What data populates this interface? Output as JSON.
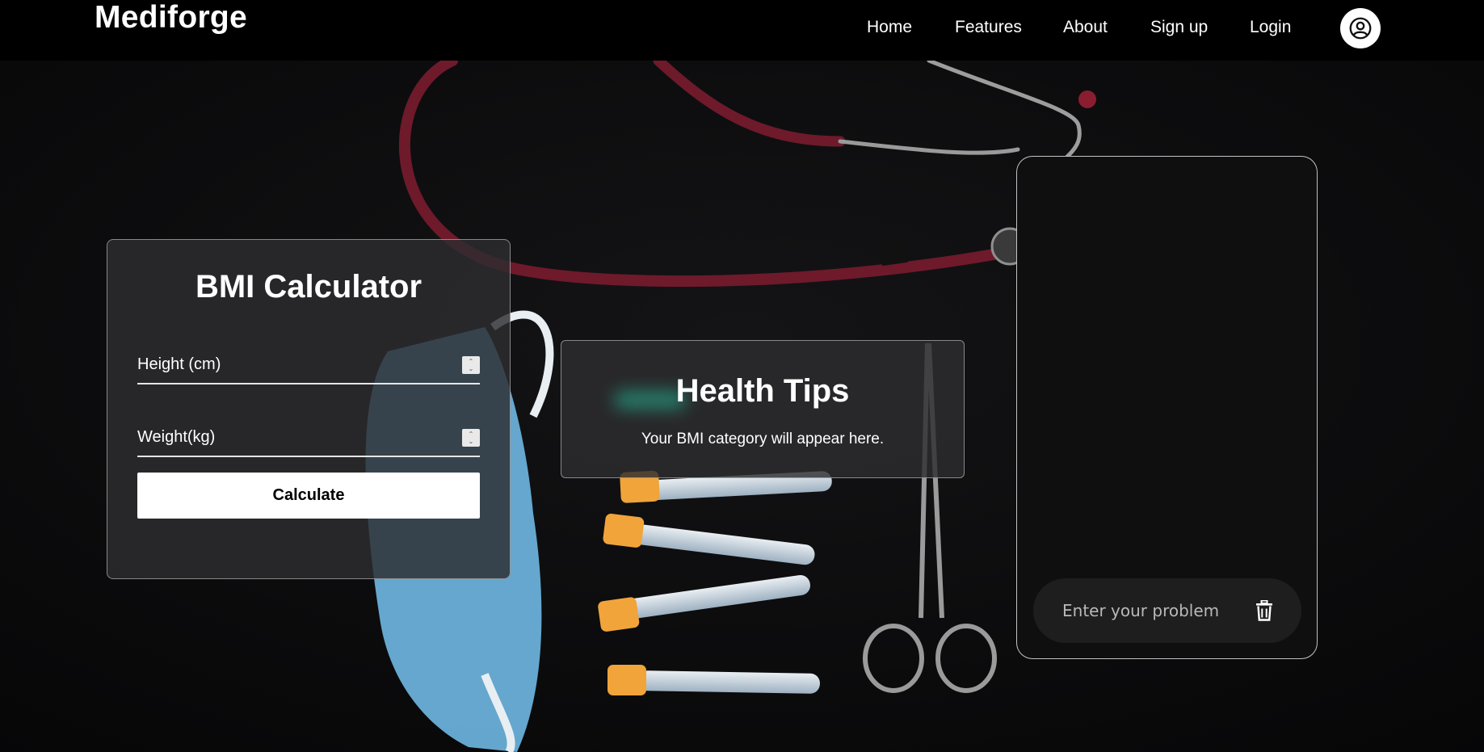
{
  "navbar": {
    "brand": "Mediforge",
    "links": [
      {
        "label": "Home"
      },
      {
        "label": "Features"
      },
      {
        "label": "About"
      },
      {
        "label": "Sign up"
      },
      {
        "label": "Login"
      }
    ],
    "profile_icon": "user-circle-icon"
  },
  "bmi": {
    "title": "BMI Calculator",
    "height_placeholder": "Height (cm)",
    "weight_placeholder": "Weight(kg)",
    "calculate_label": "Calculate"
  },
  "tips": {
    "title": "Health Tips",
    "text": "Your BMI category will appear here."
  },
  "chat": {
    "input_placeholder": "Enter your problem",
    "clear_icon": "trash-icon"
  },
  "colors": {
    "navbar_bg": "#000000",
    "panel_bg": "#2d2d2f",
    "stethoscope": "#6e1a2b",
    "mask": "#6fb8e3",
    "tube_cap": "#f0a43a"
  }
}
